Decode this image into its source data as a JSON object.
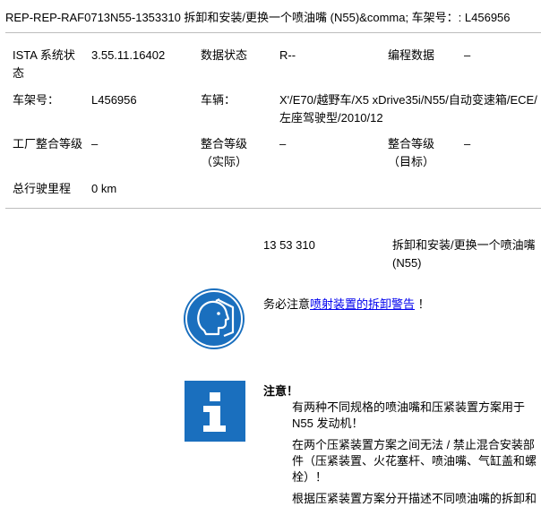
{
  "title": "REP-REP-RAF0713N55-1353310  拆卸和安装/更换一个喷油嘴 (N55)&comma; 车架号：: L456956",
  "vehicle_info": {
    "ista_label": "ISTA 系统状态",
    "ista_value": "3.55.11.16402",
    "data_status_label": "数据状态",
    "data_status_value": "R--",
    "programming_data_label": "编程数据",
    "programming_data_value": "–",
    "vin_label": "车架号：",
    "vin_value": "L456956",
    "vehicle_label": "车辆：",
    "vehicle_value": "X'/E70/越野车/X5 xDrive35i/N55/自动变速箱/ECE/左座驾驶型/2010/12",
    "factory_level_label": "工厂整合等级",
    "factory_level_value": "–",
    "actual_level_label": "整合等级（实际）",
    "actual_level_value": "–",
    "target_level_label": "整合等级（目标）",
    "target_level_value": "–",
    "mileage_label": "总行驶里程",
    "mileage_value": "0 km"
  },
  "document": {
    "number": "13 53 310",
    "title": "拆卸和安装/更换一个喷油嘴 (N55)"
  },
  "warning": {
    "prefix": "务必注意",
    "link": "喷射装置的拆卸警告",
    "suffix": "！"
  },
  "note": {
    "title": "注意！",
    "paragraphs": [
      "有两种不同规格的喷油嘴和压紧装置方案用于 N55 发动机！",
      "在两个压紧装置方案之间无法 / 禁止混合安装部件（压紧装置、火花塞杆、喷油嘴、气缸盖和螺栓）！",
      "根据压紧装置方案分开描述不同喷油嘴的拆卸和安装。"
    ]
  },
  "colors": {
    "icon_blue": "#1a6fbe",
    "link": "#0000ee",
    "rule": "#bdbdbd"
  }
}
